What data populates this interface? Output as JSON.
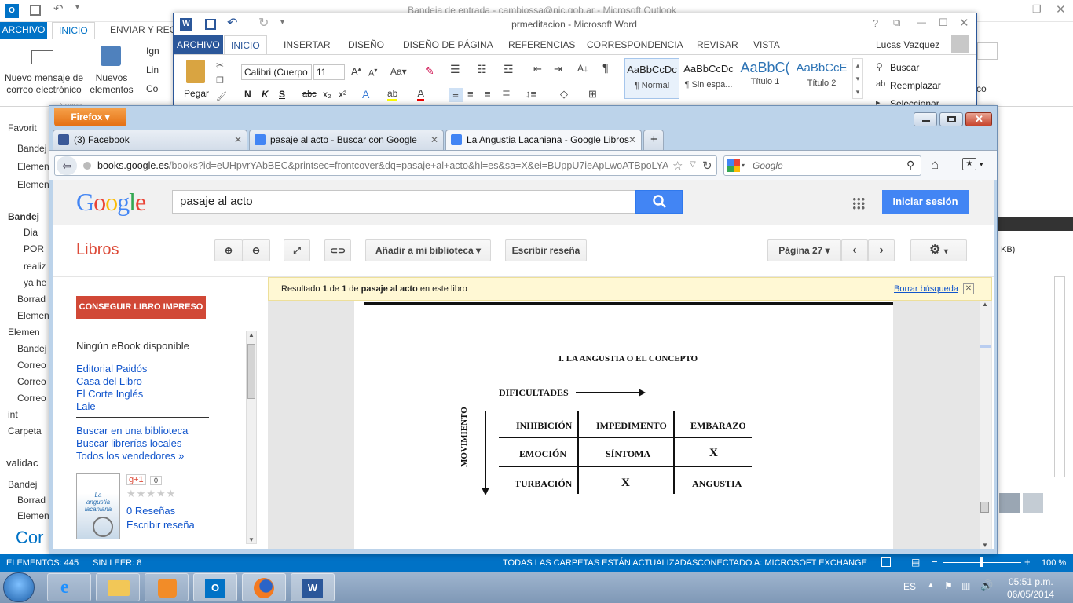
{
  "outlook": {
    "title": "Bandeja de entrada - cambiossa@nic.gob.ar - Microsoft Outlook",
    "tabs": [
      "ARCHIVO",
      "INICIO",
      "ENVIAR Y RECIB"
    ],
    "new_mail": "Nuevo mensaje de correo electrónico",
    "new_items": "Nuevos elementos",
    "new_items_partial": "Nuevo",
    "ignore_partial": "Ign",
    "clean_partial": "Lin",
    "co_partial": "Co",
    "folders": [
      "Favorit",
      "Bandej",
      "Elemen",
      "Elemen",
      "Bandej",
      "Dia",
      "POR",
      "realiz",
      "ya he",
      "Borrad",
      "Elemen",
      "Elemen",
      "Bandej",
      "Correo",
      "Correo",
      "Correo",
      "int",
      "Carpeta",
      "validac",
      "Bandej",
      "Borrad",
      "Elemen"
    ],
    "cor_partial": "Cor",
    "right_kb": "KB)",
    "right_co": "co",
    "status": {
      "items": "ELEMENTOS: 445",
      "unread": "SIN LEER: 8",
      "folders_updated": "TODAS LAS CARPETAS ESTÁN ACTUALIZADAS.",
      "connected": "CONECTADO A: MICROSOFT EXCHANGE",
      "zoom": "100 %"
    }
  },
  "word": {
    "title": "prmeditacion - Microsoft Word",
    "help": "?",
    "user": "Lucas Vazquez",
    "tabs": [
      "ARCHIVO",
      "INICIO",
      "INSERTAR",
      "DISEÑO",
      "DISEÑO DE PÁGINA",
      "REFERENCIAS",
      "CORRESPONDENCIA",
      "REVISAR",
      "VISTA"
    ],
    "paste": "Pegar",
    "font": "Calibri (Cuerpo",
    "size": "11",
    "bold": "N",
    "italic": "K",
    "underline": "S",
    "strike": "abc",
    "sub": "x₂",
    "sup": "x²",
    "styles": [
      {
        "preview": "AaBbCcDc",
        "name": "¶ Normal"
      },
      {
        "preview": "AaBbCcDc",
        "name": "¶ Sin espa..."
      },
      {
        "preview": "AaBbC(",
        "name": "Título 1"
      },
      {
        "preview": "AaBbCcE",
        "name": "Título 2"
      }
    ],
    "find": "Buscar",
    "replace": "Reemplazar",
    "select": "Seleccionar"
  },
  "firefox": {
    "menu": "Firefox",
    "tabs": [
      {
        "label": "(3) Facebook",
        "color": "#3b5998"
      },
      {
        "label": "pasaje al acto - Buscar con Google",
        "color": "#4285f4"
      },
      {
        "label": "La Angustia Lacaniana - Google Libros",
        "color": "#4285f4"
      }
    ],
    "new_tab": "+",
    "url_domain": "books.google.es",
    "url_rest": "/books?id=eUHpvrYAbBEC&printsec=frontcover&dq=pasaje+al+acto&hl=es&sa=X&ei=BUppU7ieApLwoATBpoLYAg&v",
    "search_placeholder": "Google"
  },
  "google": {
    "query": "pasaje al acto",
    "signin": "Iniciar sesión",
    "libros": "Libros",
    "add_library": "Añadir a mi biblioteca",
    "write_review": "Escribir reseña",
    "page": "Página 27",
    "buy_button": "CONSEGUIR LIBRO IMPRESO",
    "no_ebook": "Ningún eBook disponible",
    "sellers": [
      "Editorial Paidós",
      "Casa del Libro",
      "El Corte Inglés",
      "Laie"
    ],
    "library": "Buscar en una biblioteca",
    "local": "Buscar librerías locales",
    "all_sellers": "Todos los vendedores »",
    "gplus": "g+1",
    "gplus_count": "0",
    "reviews": "0 Reseñas",
    "write_review_link": "Escribir reseña",
    "result_prefix": "Resultado",
    "result_n": "1",
    "result_of": "de",
    "result_total": "1",
    "result_de": "de",
    "result_query": "pasaje al acto",
    "result_suffix": "en este libro",
    "clear_search": "Borrar búsqueda",
    "cover_title": "La angustia lacaniana",
    "book": {
      "heading": "I. LA ANGUSTIA O EL CONCEPTO",
      "difficulties": "DIFICULTADES",
      "movement": "MOVIMIENTO",
      "rows": [
        [
          "INHIBICIÓN",
          "IMPEDIMENTO",
          "EMBARAZO"
        ],
        [
          "EMOCIÓN",
          "SÍNTOMA",
          "X"
        ],
        [
          "TURBACIÓN",
          "X",
          "ANGUSTIA"
        ]
      ]
    }
  },
  "taskbar": {
    "lang": "ES",
    "time": "05:51 p.m.",
    "date": "06/05/2014"
  }
}
